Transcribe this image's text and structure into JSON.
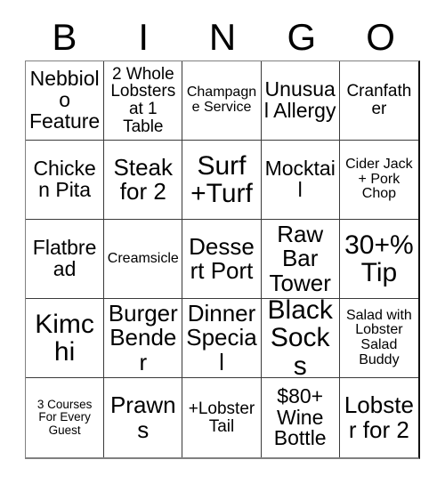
{
  "header": {
    "letters": [
      "B",
      "I",
      "N",
      "G",
      "O"
    ]
  },
  "grid": {
    "rows": 5,
    "columns": 5,
    "cells": [
      {
        "text": "Nebbiolo Feature",
        "size": "lg"
      },
      {
        "text": "2 Whole Lobsters at 1 Table",
        "size": "md"
      },
      {
        "text": "Champagne Service",
        "size": "sm"
      },
      {
        "text": "Unusual Allergy",
        "size": "lg"
      },
      {
        "text": "Cranfather",
        "size": "md"
      },
      {
        "text": "Chicken Pita",
        "size": "lg"
      },
      {
        "text": "Steak for 2",
        "size": "xl"
      },
      {
        "text": "Surf +Turf",
        "size": "xxl"
      },
      {
        "text": "Mocktail",
        "size": "lg"
      },
      {
        "text": "Cider Jack + Pork Chop",
        "size": "sm"
      },
      {
        "text": "Flatbread",
        "size": "lg"
      },
      {
        "text": "Creamsicle",
        "size": "sm"
      },
      {
        "text": "Dessert Port",
        "size": "xl"
      },
      {
        "text": "Raw Bar Tower",
        "size": "xl"
      },
      {
        "text": "30+% Tip",
        "size": "xxl"
      },
      {
        "text": "Kimchi",
        "size": "xxl"
      },
      {
        "text": "Burger Bender",
        "size": "xl"
      },
      {
        "text": "Dinner Special",
        "size": "xl"
      },
      {
        "text": "Black Socks",
        "size": "xxl"
      },
      {
        "text": "Salad with Lobster Salad Buddy",
        "size": "sm"
      },
      {
        "text": "3 Courses For Every Guest",
        "size": "xs"
      },
      {
        "text": "Prawns",
        "size": "xl"
      },
      {
        "text": "+Lobster Tail",
        "size": "md"
      },
      {
        "text": "$80+ Wine Bottle",
        "size": "lg"
      },
      {
        "text": "Lobster for 2",
        "size": "xl"
      }
    ]
  },
  "style": {
    "background_color": "#ffffff",
    "text_color": "#000000",
    "grid_line_color": "#3a3a3a"
  }
}
